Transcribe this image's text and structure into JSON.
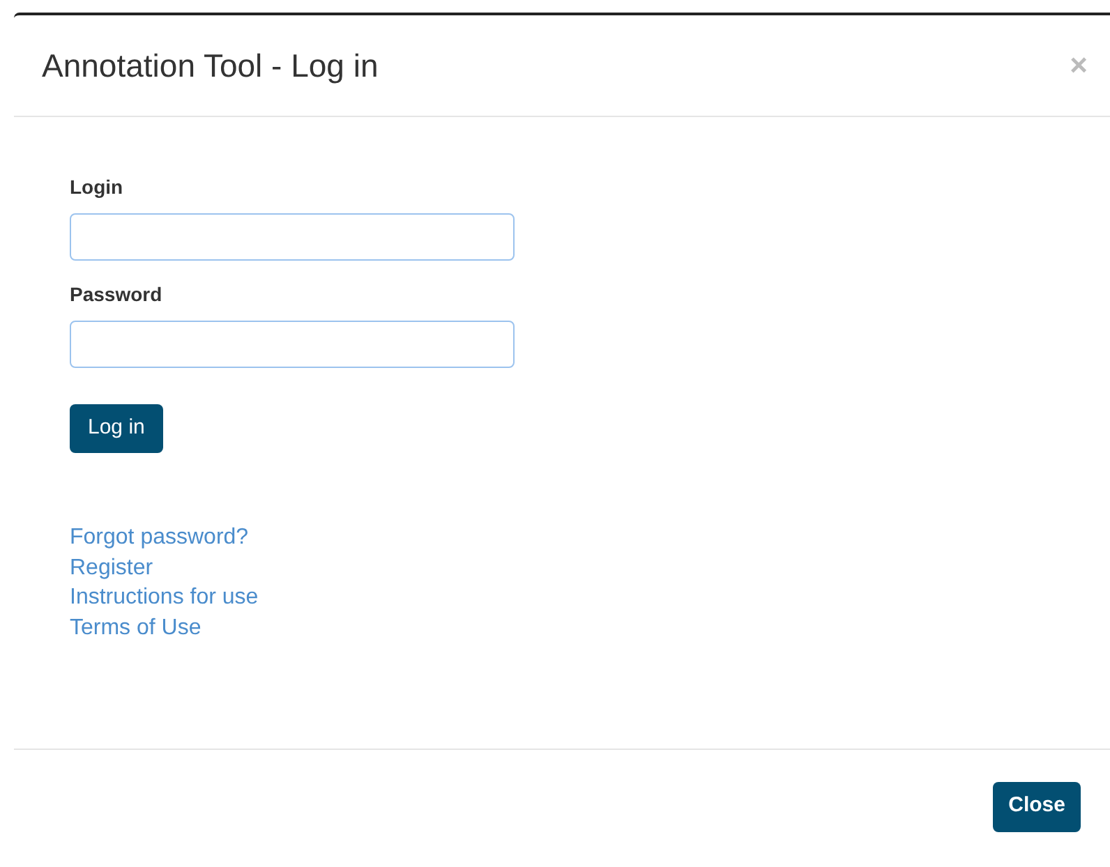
{
  "dialog": {
    "title": "Annotation Tool - Log in",
    "close_icon": "×"
  },
  "fields": [
    {
      "label": "Login"
    },
    {
      "label": "Password"
    }
  ],
  "submit_button": "Log in",
  "links": [
    "Forgot password?",
    "Register",
    "Instructions for use",
    "Terms of Use"
  ],
  "footer_button": "Close"
}
